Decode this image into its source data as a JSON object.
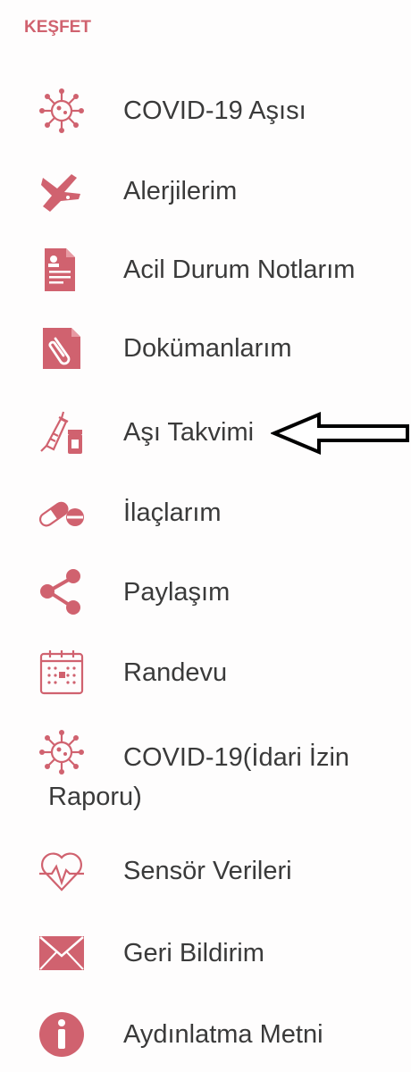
{
  "section": {
    "title": "KEŞFET"
  },
  "menu": {
    "items": [
      {
        "label": "COVID-19 Aşısı",
        "icon": "virus-icon"
      },
      {
        "label": "Alerjilerim",
        "icon": "allergy-hand-icon"
      },
      {
        "label": "Acil Durum Notlarım",
        "icon": "emergency-document-icon"
      },
      {
        "label": "Dokümanlarım",
        "icon": "paperclip-document-icon"
      },
      {
        "label": "Aşı Takvimi",
        "icon": "syringe-vial-icon"
      },
      {
        "label": "İlaçlarım",
        "icon": "pills-icon"
      },
      {
        "label": "Paylaşım",
        "icon": "share-icon"
      },
      {
        "label": "Randevu",
        "icon": "calendar-icon"
      },
      {
        "label": "COVID-19(İdari İzin Raporu)",
        "icon": "virus-icon"
      },
      {
        "label": "Sensör Verileri",
        "icon": "heart-pulse-icon"
      },
      {
        "label": "Geri Bildirim",
        "icon": "envelope-icon"
      },
      {
        "label": "Aydınlatma Metni",
        "icon": "info-icon"
      }
    ]
  },
  "annotation": {
    "arrow": "left-arrow-icon"
  },
  "colors": {
    "accent": "#d0626f",
    "text": "#3a3a3a",
    "background": "#fefdfd"
  }
}
